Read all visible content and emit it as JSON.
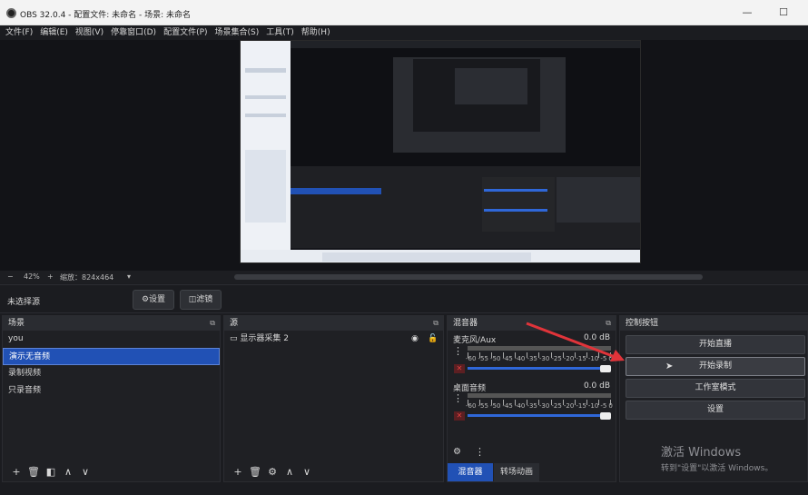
{
  "window": {
    "title": "OBS 32.0.4 - 配置文件: 未命名 - 场景: 未命名",
    "minimize": "—",
    "maximize": "☐"
  },
  "menu": [
    "文件(F)",
    "编辑(E)",
    "视图(V)",
    "停靠窗口(D)",
    "配置文件(P)",
    "场景集合(S)",
    "工具(T)",
    "帮助(H)"
  ],
  "zoom": {
    "minus": "−",
    "level": "42%",
    "plus": "+",
    "scale": "缩放：824x464",
    "dropdown": "▾"
  },
  "source_bar": {
    "no_selection": "未选择源",
    "properties": "设置",
    "filters": "滤镜"
  },
  "scenes": {
    "title": "场景",
    "items": [
      "you",
      "演示无音频",
      "录制视频",
      "只录音频"
    ],
    "selected": 1
  },
  "sources": {
    "title": "源",
    "items": [
      {
        "name": "显示器采集 2"
      }
    ]
  },
  "mixer": {
    "title": "混音器",
    "channels": [
      {
        "name": "麦克风/Aux",
        "db": "0.0 dB",
        "volume": 1.0
      },
      {
        "name": "桌面音频",
        "db": "0.0 dB",
        "volume": 1.0
      }
    ],
    "scale": [
      "-60",
      "-55",
      "-50",
      "-45",
      "-40",
      "-35",
      "-30",
      "-25",
      "-20",
      "-15",
      "-10",
      "-5",
      "0"
    ],
    "tabs": [
      "混音器",
      "转场动画"
    ],
    "active_tab": 0
  },
  "controls": {
    "title": "控制按钮",
    "buttons": [
      "开始直播",
      "开始录制",
      "工作室模式",
      "设置"
    ]
  },
  "activation": {
    "line1": "激活 Windows",
    "line2": "转到\"设置\"以激活 Windows。"
  },
  "colors": {
    "accent": "#2151b5",
    "arrow": "#e0343a",
    "fader": "#2f67d8"
  },
  "icons": {
    "float": "float-dock-icon",
    "eye": "eye-icon",
    "lock": "lock-icon",
    "gear": "gear-icon"
  }
}
